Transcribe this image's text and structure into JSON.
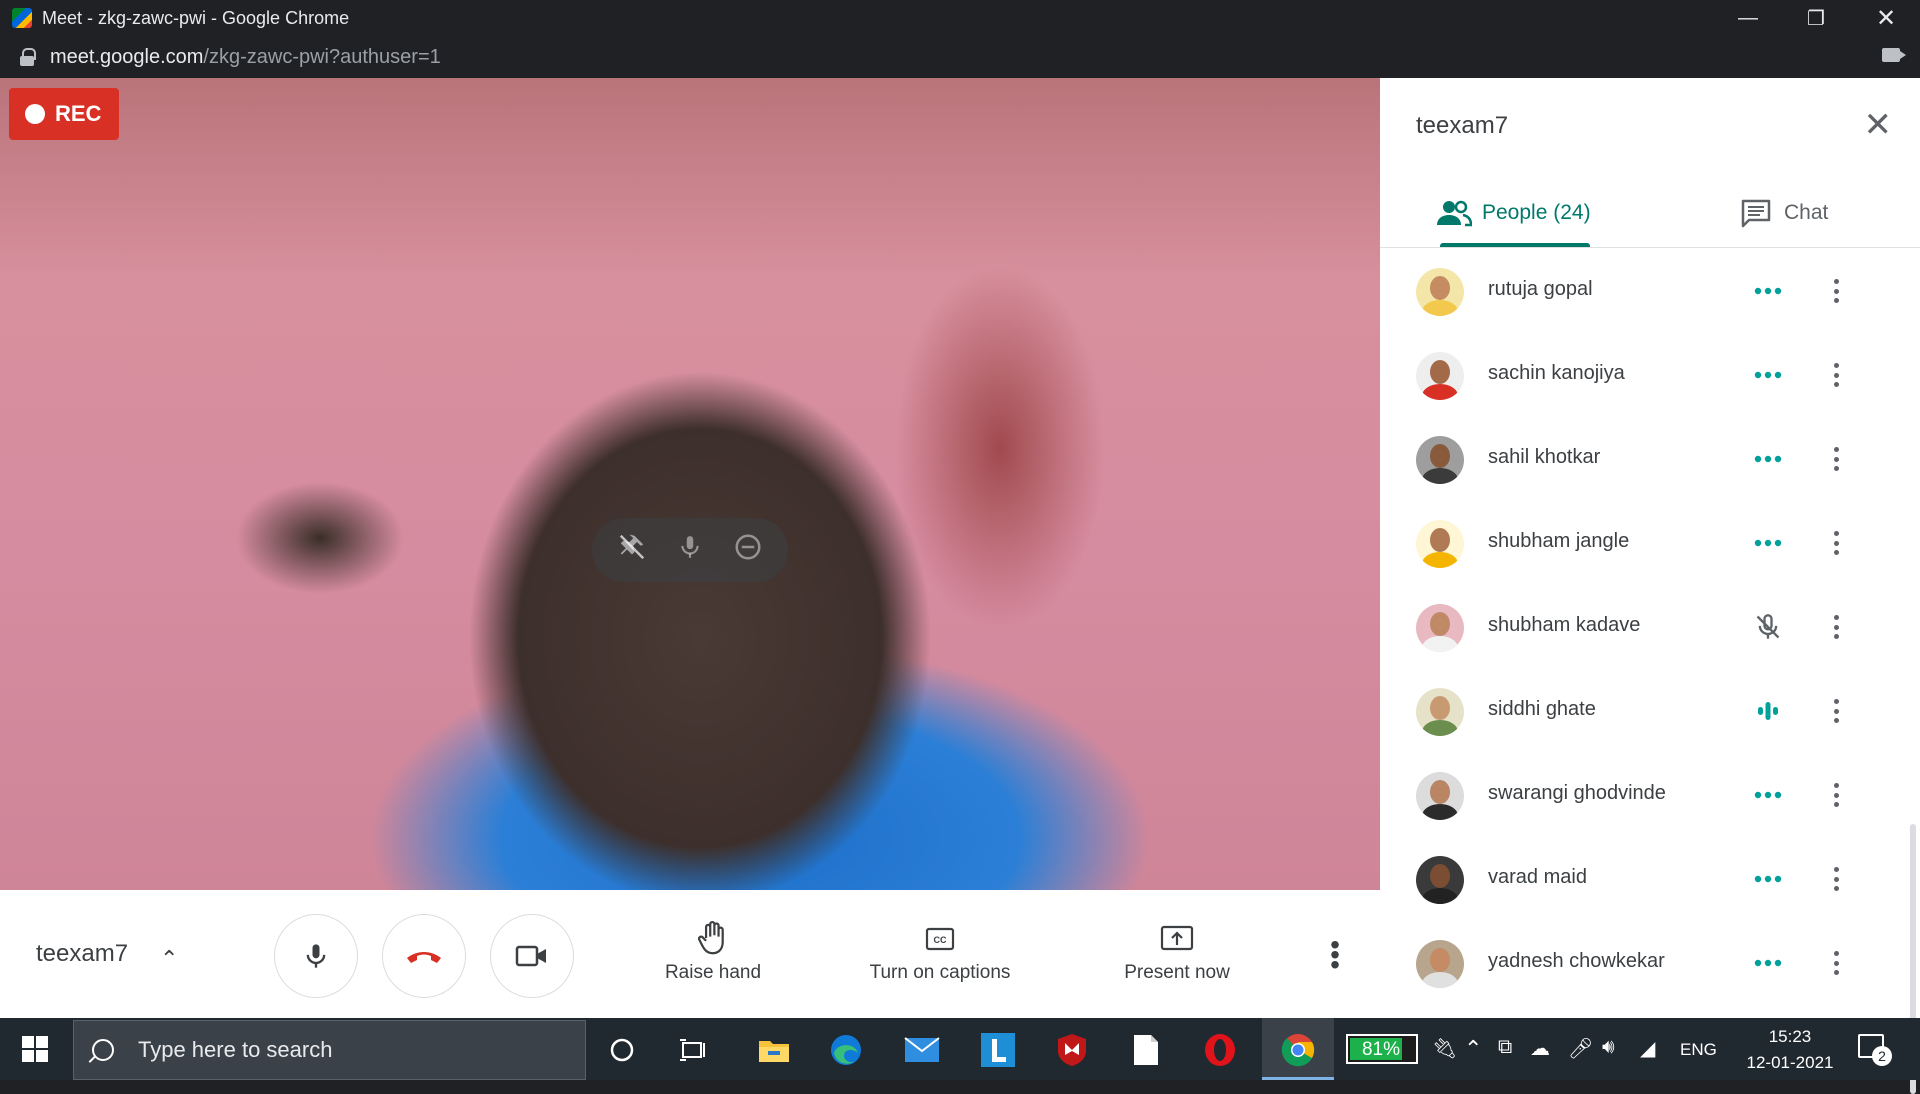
{
  "window": {
    "title": "Meet - zkg-zawc-pwi - Google Chrome"
  },
  "address": {
    "host": "meet.google.com",
    "path": "/zkg-zawc-pwi?authuser=1"
  },
  "video": {
    "rec_label": "REC"
  },
  "controls": {
    "meeting_name": "teexam7",
    "raise_hand": "Raise hand",
    "captions": "Turn on captions",
    "present": "Present now"
  },
  "panel": {
    "title": "teexam7",
    "tabs": {
      "people": "People (24)",
      "chat": "Chat"
    },
    "participants": [
      {
        "name": "rutuja gopal",
        "status": "more-dots-icon",
        "skin": "#c58c61",
        "shirt": "#f2c94c",
        "bg": "#f3e6a8"
      },
      {
        "name": "sachin kanojiya",
        "status": "more-dots-icon",
        "skin": "#a36a4a",
        "shirt": "#d93025",
        "bg": "#eeeeee"
      },
      {
        "name": "sahil khotkar",
        "status": "more-dots-icon",
        "skin": "#8a5a3c",
        "shirt": "#3b3b3b",
        "bg": "#9e9e9e"
      },
      {
        "name": "shubham jangle",
        "status": "more-dots-icon",
        "skin": "#b07a55",
        "shirt": "#f4b400",
        "bg": "#fff6d5"
      },
      {
        "name": "shubham kadave",
        "status": "mic-off-icon",
        "skin": "#c08a67",
        "shirt": "#f2f2f2",
        "bg": "#e8b9c0"
      },
      {
        "name": "siddhi ghate",
        "status": "speaking-icon",
        "skin": "#c89a72",
        "shirt": "#6b8e4e",
        "bg": "#e6e1c9"
      },
      {
        "name": "swarangi ghodvinde",
        "status": "more-dots-icon",
        "skin": "#b98562",
        "shirt": "#2b2b2b",
        "bg": "#dcdcdc"
      },
      {
        "name": "varad maid",
        "status": "more-dots-icon",
        "skin": "#7b4e33",
        "shirt": "#222222",
        "bg": "#3a3a3a"
      },
      {
        "name": "yadnesh chowkekar",
        "status": "more-dots-icon",
        "skin": "#c48b64",
        "shirt": "#e0e0e0",
        "bg": "#b7a58d"
      }
    ]
  },
  "taskbar": {
    "search_placeholder": "Type here to search",
    "battery": "81%",
    "battery_level": 0.81,
    "language": "ENG",
    "time": "15:23",
    "date": "12-01-2021",
    "notifications": "2"
  },
  "colors": {
    "accent": "#00796b",
    "rec": "#d93025",
    "hangup": "#d93025",
    "taskbar": "#202830"
  }
}
